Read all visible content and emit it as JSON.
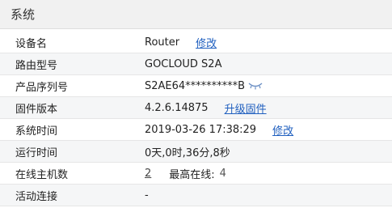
{
  "section": {
    "title": "系统"
  },
  "rows": {
    "device_name": {
      "label": "设备名",
      "value": "Router",
      "action": "修改"
    },
    "router_model": {
      "label": "路由型号",
      "value": "GOCLOUD S2A"
    },
    "serial": {
      "label": "产品序列号",
      "value": "S2AE64**********B",
      "icon": "eye-closed-icon"
    },
    "firmware": {
      "label": "固件版本",
      "value": "4.2.6.14875",
      "action": "升级固件"
    },
    "system_time": {
      "label": "系统时间",
      "value": "2019-03-26 17:38:29",
      "action": "修改"
    },
    "uptime": {
      "label": "运行时间",
      "value": "0天,0时,36分,8秒"
    },
    "online_hosts": {
      "label": "在线主机数",
      "value": "2",
      "peak_label": "最高在线:",
      "peak_value": "4"
    },
    "active_connections": {
      "label": "活动连接",
      "value": "-"
    }
  },
  "colors": {
    "link": "#1f5fbf",
    "header_bg": "#f1f1f1",
    "alt_row": "#f5f6f7"
  }
}
